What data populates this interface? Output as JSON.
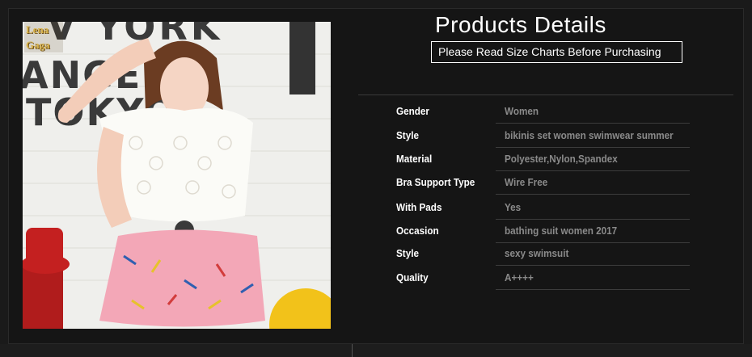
{
  "brand": {
    "line1": "Lena",
    "line2": "Gaga"
  },
  "photo": {
    "wall_text_1": "V YORK",
    "wall_text_2": "ANGELES",
    "wall_text_3": "TOKYO"
  },
  "header": {
    "title": "Products Details",
    "subtitle": "Please Read Size Charts Before Purchasing"
  },
  "details": [
    {
      "label": "Gender",
      "value": "Women"
    },
    {
      "label": "Style",
      "value": "bikinis set women swimwear summer"
    },
    {
      "label": "Material",
      "value": "Polyester,Nylon,Spandex"
    },
    {
      "label": "Bra Support Type",
      "value": "Wire Free"
    },
    {
      "label": "With Pads",
      "value": "Yes"
    },
    {
      "label": "Occasion",
      "value": "bathing suit women 2017"
    },
    {
      "label": "Style",
      "value": "sexy swimsuit"
    },
    {
      "label": "Quality",
      "value": "A++++"
    }
  ],
  "colors": {
    "background": "#151515",
    "label": "#ffffff",
    "value": "#8a8a8a",
    "brand": "#d8b24a"
  }
}
